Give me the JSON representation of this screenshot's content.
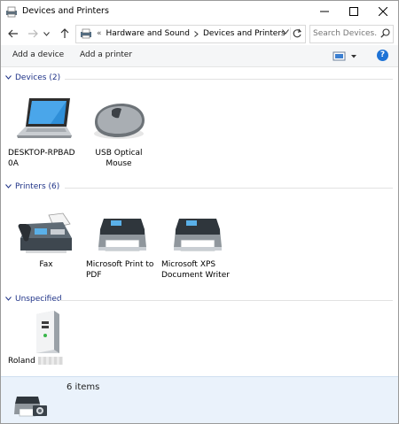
{
  "window": {
    "title": "Devices and Printers"
  },
  "address": {
    "overflow": "«",
    "crumbs": [
      "Hardware and Sound",
      "Devices and Printers"
    ]
  },
  "search": {
    "placeholder": "Search Devices..."
  },
  "toolbar": {
    "add_device": "Add a device",
    "add_printer": "Add a printer",
    "help": "?"
  },
  "groups": {
    "devices": {
      "label": "Devices (2)",
      "items": [
        {
          "name": "DESKTOP-RPBAD\n0A",
          "icon": "laptop-icon"
        },
        {
          "name": "USB Optical\nMouse",
          "icon": "mouse-icon"
        }
      ]
    },
    "printers": {
      "label": "Printers (6)",
      "items": [
        {
          "name": "Fax",
          "icon": "fax-icon"
        },
        {
          "name": "Microsoft Print to\nPDF",
          "icon": "printer-icon"
        },
        {
          "name": "Microsoft XPS\nDocument Writer",
          "icon": "printer-icon"
        }
      ]
    },
    "unspecified": {
      "label": "Unspecified",
      "items": [
        {
          "name": "Roland",
          "icon": "server-tower-icon"
        }
      ]
    }
  },
  "details": {
    "count": "6 items"
  },
  "colors": {
    "accent": "#1e73d6",
    "group_header": "#1e3287",
    "details_bg": "#eaf2fb"
  }
}
